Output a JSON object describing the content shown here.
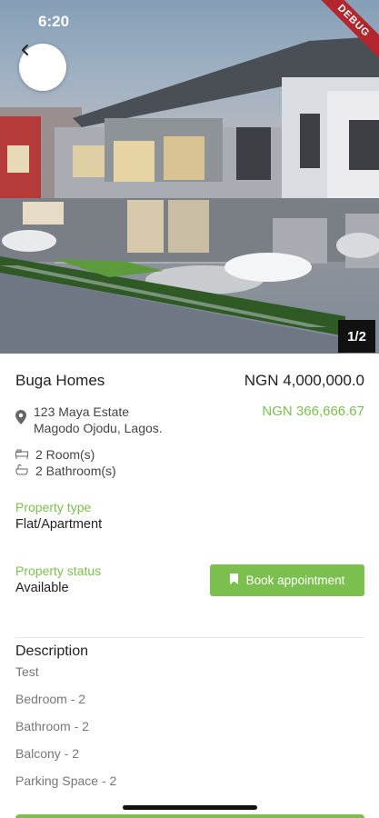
{
  "status_bar": {
    "time": "6:20",
    "debug_label": "DEBUG"
  },
  "gallery": {
    "pager": "1/2"
  },
  "property": {
    "title": "Buga Homes",
    "price": "NGN 4,000,000.0",
    "monthly_price": "NGN 366,666.67",
    "address_line1": "123 Maya Estate",
    "address_line2": "Magodo Ojodu, Lagos.",
    "rooms": "2 Room(s)",
    "bathrooms": "2 Bathroom(s)",
    "type_label": "Property type",
    "type_value": "Flat/Apartment",
    "status_label": "Property status",
    "status_value": "Available"
  },
  "actions": {
    "book_label": "Book appointment"
  },
  "description": {
    "title": "Description",
    "lines": [
      "Test",
      "Bedroom - 2",
      "Bathroom - 2",
      "Balcony - 2",
      "Parking Space - 2"
    ]
  },
  "colors": {
    "accent": "#7bbf4f",
    "pager_bg": "#111111",
    "debug": "#b3262d"
  },
  "icons": [
    "chevron-left-icon",
    "location-pin-icon",
    "bed-icon",
    "bath-icon",
    "bookmark-icon",
    "wifi-icon"
  ]
}
